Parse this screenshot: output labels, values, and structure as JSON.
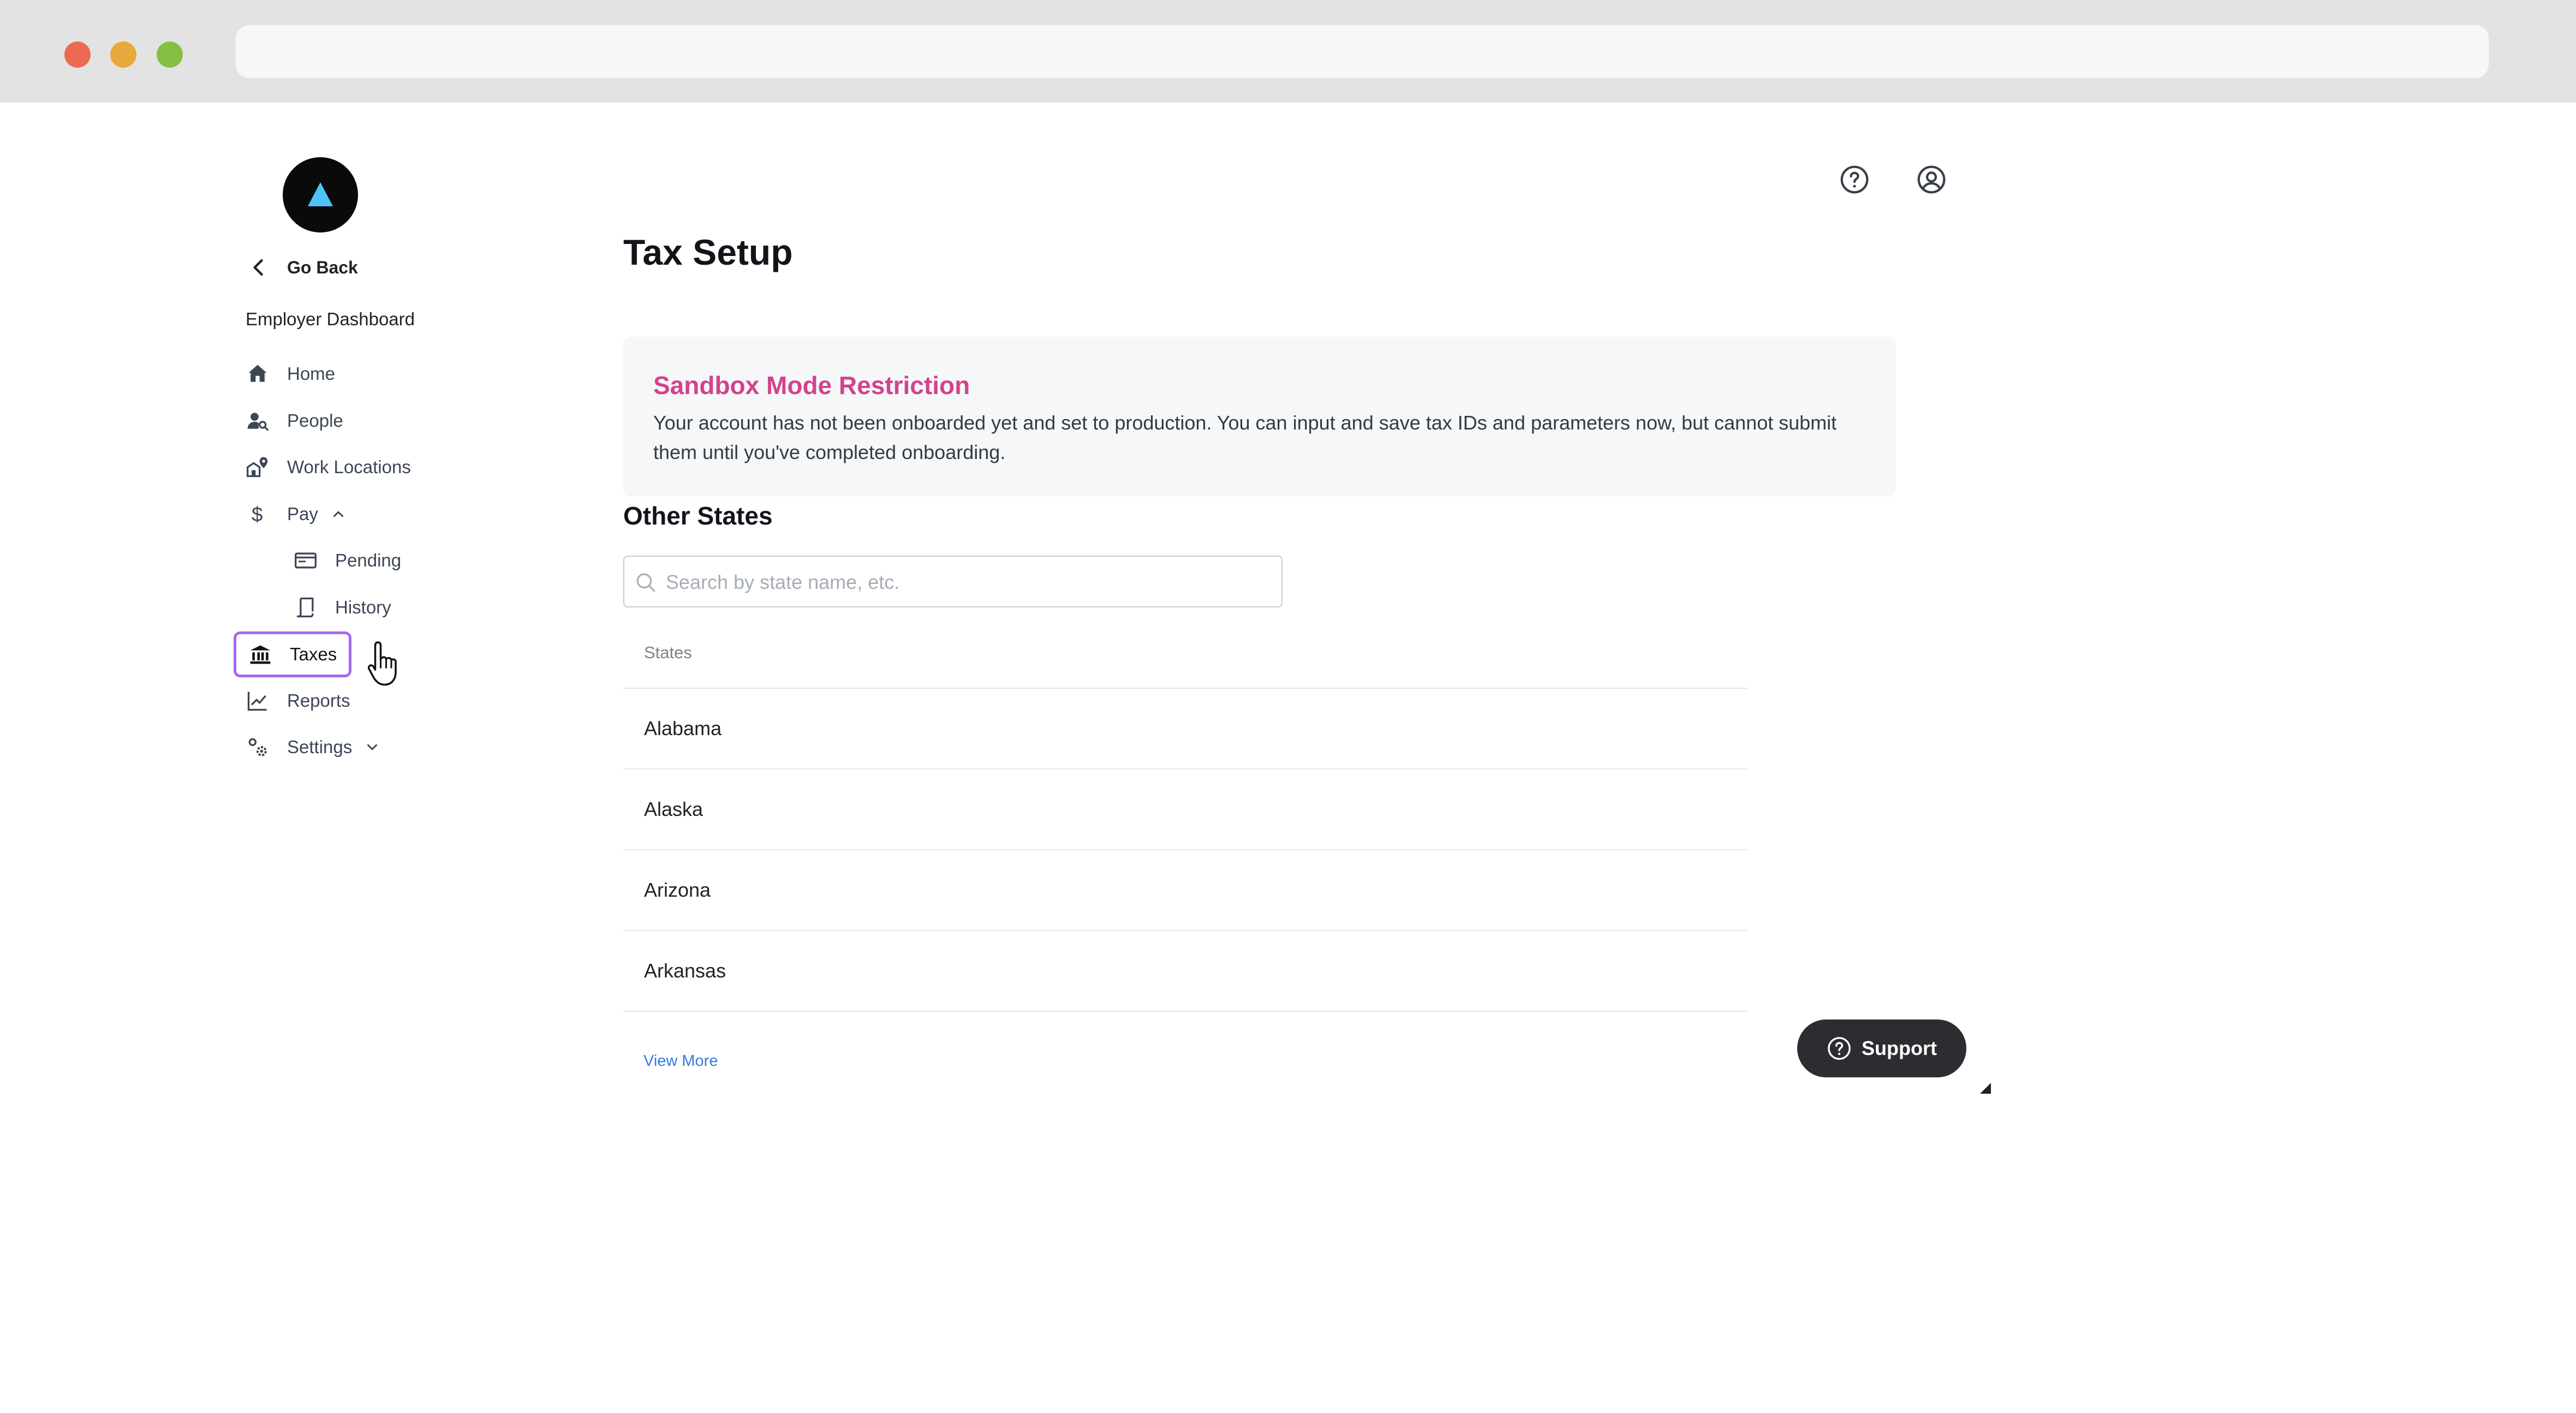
{
  "nav": {
    "go_back": "Go Back",
    "section_title": "Employer Dashboard",
    "items": {
      "home": "Home",
      "people": "People",
      "work_locations": "Work Locations",
      "pay": "Pay",
      "pending": "Pending",
      "history": "History",
      "taxes": "Taxes",
      "reports": "Reports",
      "settings": "Settings"
    },
    "active_item": "Taxes"
  },
  "page": {
    "title": "Tax Setup"
  },
  "banner": {
    "title": "Sandbox Mode Restriction",
    "body": "Your account has not been onboarded yet and set to production. You can input and save tax IDs and parameters now, but cannot submit them until you've completed onboarding."
  },
  "other_states": {
    "heading": "Other States",
    "search_placeholder": "Search by state name, etc.",
    "column_header": "States",
    "rows": [
      "Alabama",
      "Alaska",
      "Arizona",
      "Arkansas"
    ],
    "view_more": "View More"
  },
  "support": {
    "label": "Support"
  },
  "colors": {
    "brand_accent": "#4fc3f7",
    "banner_title": "#d2438e",
    "active_outline": "#a569f0",
    "link": "#3579e6",
    "support_bg": "#2c2d30"
  },
  "icons": {
    "logo": "triangle-logo-icon",
    "help": "help-circle-icon",
    "account": "user-circle-icon",
    "search": "search-icon",
    "support": "help-circle-icon"
  }
}
